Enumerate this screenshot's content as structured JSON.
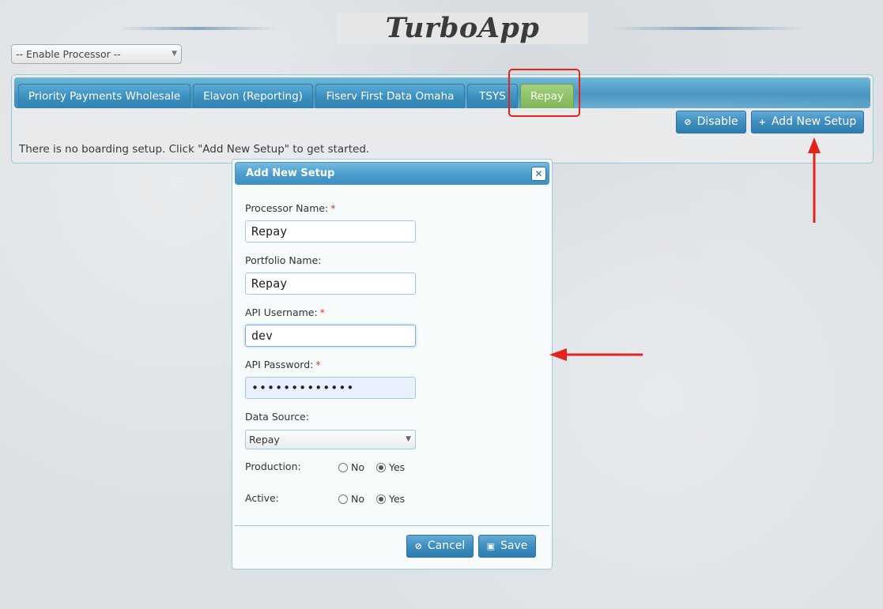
{
  "app": {
    "title": "TurboApp"
  },
  "processor_select": {
    "value": "-- Enable Processor --"
  },
  "tabs": [
    {
      "label": "Priority Payments Wholesale",
      "active": false
    },
    {
      "label": "Elavon (Reporting)",
      "active": false
    },
    {
      "label": "Fiserv First Data Omaha",
      "active": false
    },
    {
      "label": "TSYS",
      "active": false
    },
    {
      "label": "Repay",
      "active": true
    }
  ],
  "toolbar": {
    "disable_label": "Disable",
    "disable_icon": "ban-icon",
    "add_label": "Add New Setup",
    "add_icon": "plus-icon"
  },
  "empty_message": "There is no boarding setup. Click \"Add New Setup\" to get started.",
  "dialog": {
    "title": "Add New Setup",
    "fields": {
      "processor_name": {
        "label": "Processor Name:",
        "required": true,
        "value": "Repay"
      },
      "portfolio_name": {
        "label": "Portfolio Name:",
        "required": false,
        "value": "Repay"
      },
      "api_username": {
        "label": "API Username:",
        "required": true,
        "value": "dev"
      },
      "api_password": {
        "label": "API Password:",
        "required": true,
        "value": "•••••••••••••"
      },
      "data_source": {
        "label": "Data Source:",
        "value": "Repay"
      },
      "production": {
        "label": "Production:",
        "options": [
          "No",
          "Yes"
        ],
        "selected": "Yes"
      },
      "active": {
        "label": "Active:",
        "options": [
          "No",
          "Yes"
        ],
        "selected": "Yes"
      }
    },
    "required_mark": "*",
    "cancel_label": "Cancel",
    "save_label": "Save"
  },
  "colors": {
    "accent": "#3f8ec1",
    "active_tab": "#8fc26a",
    "annotation": "#e3231c",
    "required": "#d63a2f"
  }
}
